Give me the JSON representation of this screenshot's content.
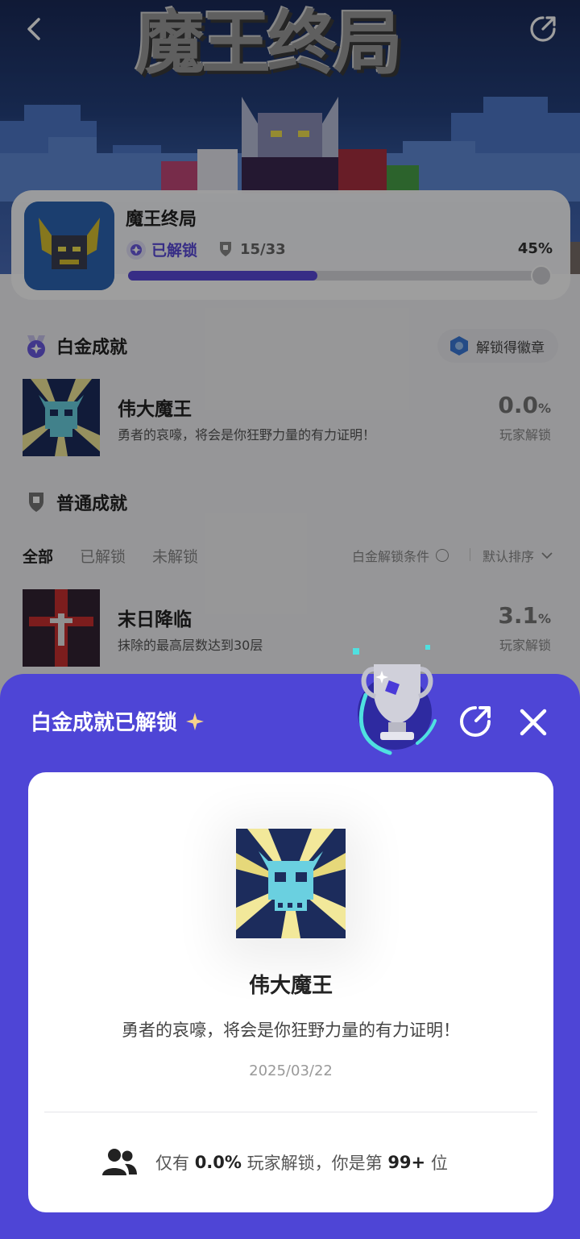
{
  "hero": {
    "title": "魔王终局"
  },
  "game": {
    "name": "魔王终局",
    "unlock_status": "已解锁",
    "trophy_count": "15/33",
    "percent_label": "45%",
    "progress": 0.45
  },
  "platinum_section": {
    "title": "白金成就",
    "badge_button": "解锁得徽章",
    "achievement": {
      "name": "伟大魔王",
      "description": "勇者的哀嚎，将会是你狂野力量的有力证明！",
      "percent": "0.0",
      "percent_unit": "%",
      "percent_label": "玩家解锁"
    }
  },
  "normal_section": {
    "title": "普通成就",
    "filters": [
      "全部",
      "已解锁",
      "未解锁"
    ],
    "active_filter": "全部",
    "condition_label": "白金解锁条件",
    "sort_label": "默认排序",
    "achievement": {
      "name": "末日降临",
      "description": "抹除的最高层数达到30层",
      "percent": "3.1",
      "percent_unit": "%",
      "percent_label": "玩家解锁"
    }
  },
  "sheet": {
    "title": "白金成就已解锁",
    "detail": {
      "name": "伟大魔王",
      "description": "勇者的哀嚎，将会是你狂野力量的有力证明！",
      "date": "2025/03/22",
      "footer_prefix": "仅有",
      "footer_percent": "0.0%",
      "footer_middle": "玩家解锁，你是第",
      "footer_rank": "99+",
      "footer_suffix": "位"
    }
  },
  "colors": {
    "accent": "#5a4ad8",
    "sheet_bg": "#4e45d6",
    "hero_bg": "#24407c"
  },
  "icons": [
    "back-arrow-icon",
    "share-icon",
    "shield-trophy-icon",
    "platinum-medal-icon",
    "badge-icon",
    "sparkle-star-icon",
    "trophy-icon",
    "close-icon",
    "users-icon",
    "circle-icon",
    "chevron-down-icon"
  ]
}
